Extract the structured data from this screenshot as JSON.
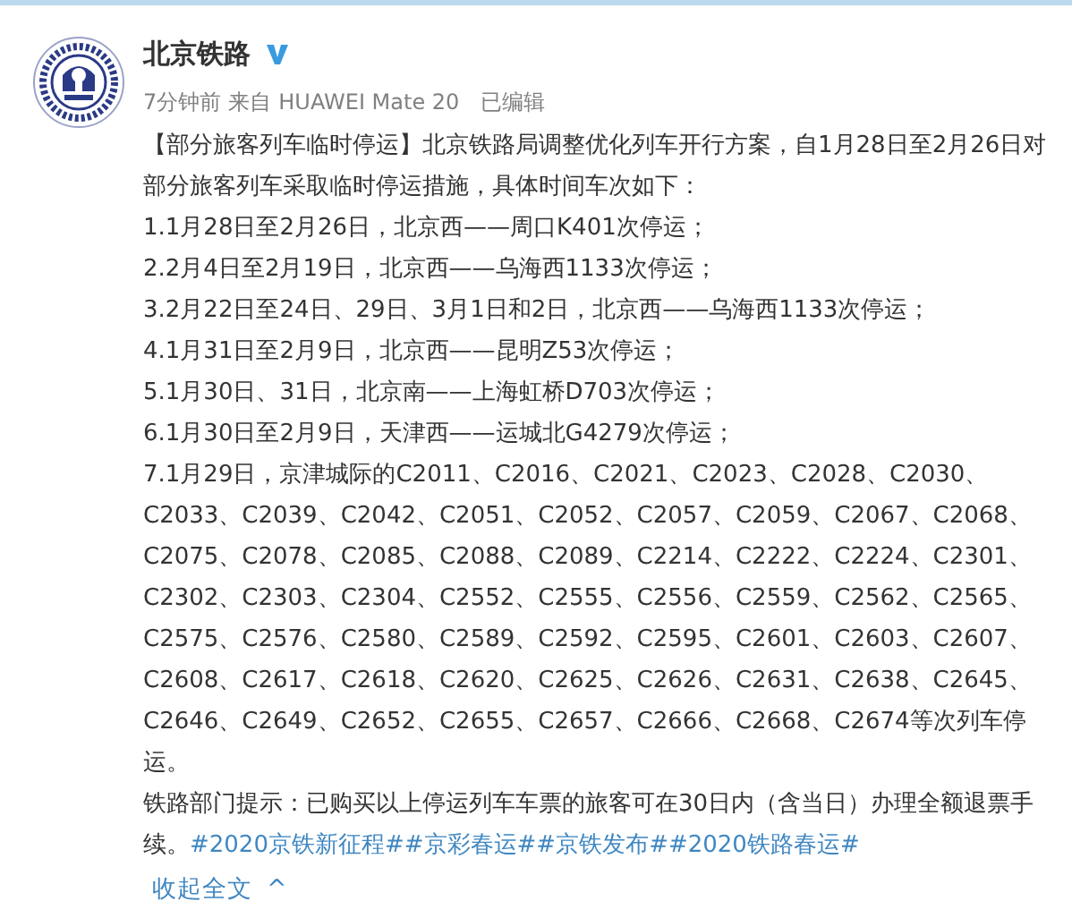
{
  "author": {
    "name": "北京铁路",
    "verified": true
  },
  "meta": {
    "time": "7分钟前",
    "source_prefix": "来自",
    "source": "HUAWEI Mate 20",
    "edited": "已编辑"
  },
  "paragraphs": [
    "【部分旅客列车临时停运】北京铁路局调整优化列车开行方案，自1月28日至2月26日对部分旅客列车采取临时停运措施，具体时间车次如下：",
    "1.1月28日至2月26日，北京西——周口K401次停运；",
    "2.2月4日至2月19日，北京西——乌海西1133次停运；",
    "3.2月22日至24日、29日、3月1日和2日，北京西——乌海西1133次停运；",
    "4.1月31日至2月9日，北京西——昆明Z53次停运；",
    "5.1月30日、31日，北京南——上海虹桥D703次停运；",
    "6.1月30日至2月9日，天津西——运城北G4279次停运；",
    "7.1月29日，京津城际的C2011、C2016、C2021、C2023、C2028、C2030、C2033、C2039、C2042、C2051、C2052、C2057、C2059、C2067、C2068、C2075、C2078、C2085、C2088、C2089、C2214、C2222、C2224、C2301、C2302、C2303、C2304、C2552、C2555、C2556、C2559、C2562、C2565、C2575、C2576、C2580、C2589、C2592、C2595、C2601、C2603、C2607、C2608、C2617、C2618、C2620、C2625、C2626、C2631、C2638、C2645、C2646、C2649、C2652、C2655、C2657、C2666、C2668、C2674等次列车停运。"
  ],
  "tip": {
    "text": "铁路部门提示：已购买以上停运列车车票的旅客可在30日内（含当日）办理全额退票手续。",
    "hashtags": [
      "#2020京铁新征程#",
      "#京彩春运#",
      "#京铁发布#",
      "#2020铁路春运#"
    ]
  },
  "collapse": {
    "label": "收起全文",
    "caret": "^"
  }
}
